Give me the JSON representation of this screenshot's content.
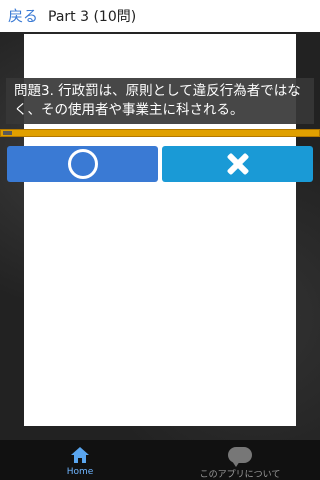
{
  "header": {
    "back_label": "戻る",
    "title": "Part 3 (10問)"
  },
  "question": {
    "text": "問題3. 行政罰は、原則として違反行為者ではなく、その使用者や事業主に科される。"
  },
  "progress": {
    "value_fraction": 0.03
  },
  "answers": {
    "true_icon": "circle-icon",
    "false_icon": "cross-icon"
  },
  "bottom_nav": {
    "home_label": "Home",
    "about_label": "このアプリについて"
  },
  "colors": {
    "accent_blue": "#3a7ad4",
    "secondary_blue": "#1a9ad6",
    "progress_orange": "#e0a000"
  }
}
